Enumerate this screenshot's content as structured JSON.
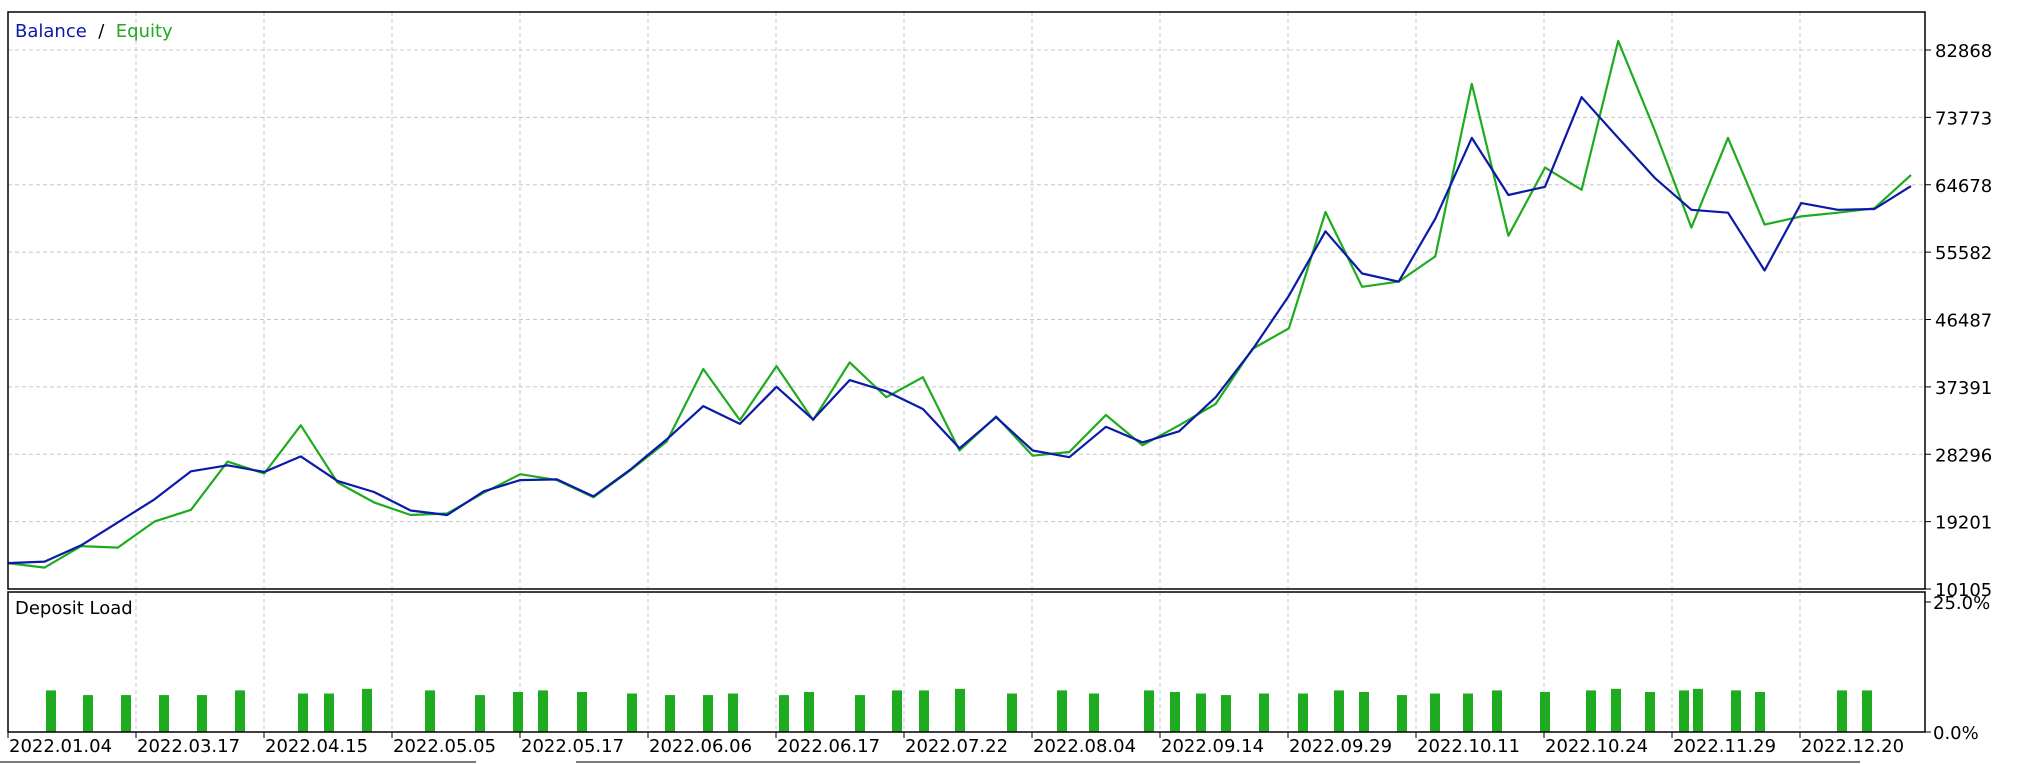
{
  "chart_data": [
    {
      "type": "line",
      "legend": {
        "placement": "top-left",
        "separator": " / "
      },
      "series": [
        {
          "name": "Balance",
          "color": "#0b1aa8",
          "values": [
            13600,
            13800,
            16000,
            19100,
            22200,
            26000,
            26800,
            25900,
            28000,
            24700,
            23200,
            20700,
            20100,
            23300,
            24800,
            24900,
            22600,
            26200,
            30300,
            34800,
            32400,
            37400,
            33000,
            38300,
            36800,
            34400,
            29100,
            33300,
            28800,
            27900,
            32000,
            29900,
            31400,
            36000,
            42400,
            49700,
            58400,
            52700,
            51600,
            60100,
            71000,
            63300,
            64400,
            76500,
            71000,
            65600,
            61300,
            60900,
            53100,
            62200,
            61300,
            61400,
            64500
          ]
        },
        {
          "name": "Equity",
          "color": "#1fab1f",
          "values": [
            13600,
            13000,
            15900,
            15700,
            19200,
            20800,
            27300,
            25700,
            32200,
            24500,
            21800,
            20100,
            20300,
            23100,
            25600,
            24800,
            22500,
            26100,
            30000,
            39800,
            32900,
            40200,
            32900,
            40700,
            36000,
            38700,
            28800,
            33400,
            28100,
            28600,
            33600,
            29500,
            32200,
            35100,
            42500,
            45300,
            61000,
            50900,
            51600,
            55000,
            78300,
            57800,
            67000,
            64000,
            84100,
            72000,
            58900,
            71000,
            59300,
            60400,
            60900,
            61500,
            66000
          ]
        }
      ],
      "ylim": [
        10105,
        88000
      ],
      "yticks": [
        10105,
        19201,
        28296,
        37391,
        46487,
        55582,
        64678,
        73773,
        82868
      ],
      "xticks": [
        "2022.01.04",
        "2022.03.17",
        "2022.04.15",
        "2022.05.05",
        "2022.05.17",
        "2022.06.06",
        "2022.06.17",
        "2022.07.22",
        "2022.08.04",
        "2022.09.14",
        "2022.09.29",
        "2022.10.11",
        "2022.10.24",
        "2022.11.29",
        "2022.12.20"
      ],
      "grid": true
    },
    {
      "type": "bar",
      "title": "Deposit Load",
      "ylim": [
        0,
        25
      ],
      "yticks": [
        "0.0%",
        "25.0%"
      ],
      "color": "#1fab1f",
      "values": [
        8.0,
        7.1,
        7.1,
        7.1,
        7.1,
        8.0,
        7.4,
        7.4,
        8.3,
        8.0,
        7.1,
        7.7,
        8.0,
        7.7,
        7.4,
        7.1,
        7.1,
        7.4,
        7.1,
        7.7,
        7.1,
        8.0,
        8.0,
        8.3,
        7.4,
        8.0,
        7.4,
        8.0,
        7.7,
        7.4,
        7.1,
        7.4,
        7.4,
        8.0,
        7.7,
        7.1,
        7.4,
        7.4,
        8.0,
        7.7,
        8.0,
        8.3,
        7.7,
        8.0,
        8.3,
        8.0,
        7.7,
        8.0,
        8.0
      ]
    }
  ]
}
